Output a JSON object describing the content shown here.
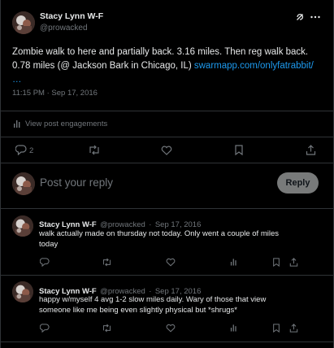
{
  "post": {
    "author_name": "Stacy Lynn W-F",
    "author_handle": "@prowacked",
    "text": "Zombie walk to here and partially back. 3.16 miles. Then reg walk back. 0.78 miles (@ Jackson Bark in Chicago, IL) ",
    "link_text": "swarmapp.com/onlyfatrabbit/",
    "link_ellipsis": "…",
    "timestamp": "11:15 PM · Sep 17, 2016",
    "engagements_label": "View post engagements",
    "reply_count": "2"
  },
  "composer": {
    "placeholder": "Post your reply",
    "reply_button": "Reply"
  },
  "replies": [
    {
      "author_name": "Stacy Lynn W-F",
      "author_handle": "@prowacked",
      "separator": "·",
      "date": "Sep 17, 2016",
      "text": "walk actually made on thursday not today. Only went a couple of miles today"
    },
    {
      "author_name": "Stacy Lynn W-F",
      "author_handle": "@prowacked",
      "separator": "·",
      "date": "Sep 17, 2016",
      "text": "happy w/myself 4 avg 1-2 slow miles daily. Wary of those that view someone like me being even slightly physical but *shrugs*"
    }
  ],
  "icons": {
    "grok": "grok-icon",
    "more": "more-icon",
    "stats": "stats-icon",
    "reply": "reply-icon",
    "repost": "repost-icon",
    "like": "like-icon",
    "bookmark": "bookmark-icon",
    "share": "share-icon"
  },
  "colors": {
    "background": "#000000",
    "text": "#e7e9ea",
    "muted": "#71767b",
    "link": "#1d9bf0",
    "divider": "#2f3336",
    "reply_button_bg": "#787a7a"
  }
}
